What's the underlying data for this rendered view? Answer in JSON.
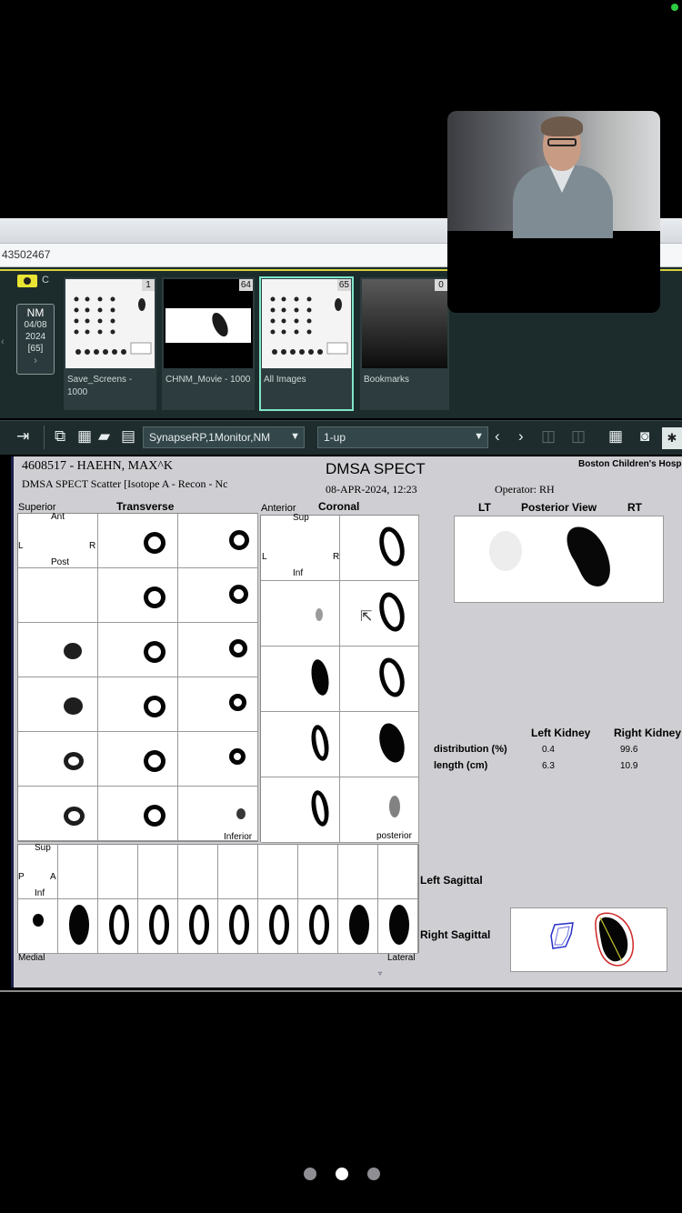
{
  "url_fragment": "43502467",
  "study": {
    "tag_letter": "C",
    "modality": "NM",
    "date_line1": "04/08",
    "date_line2": "2024",
    "count": "[65]",
    "chevron": "›"
  },
  "thumbnails": [
    {
      "label": "Save_Screens - 1000",
      "count": "1"
    },
    {
      "label": "CHNM_Movie - 1000",
      "count": "64"
    },
    {
      "label": "All Images",
      "count": "65"
    },
    {
      "label": "Bookmarks",
      "count": "0"
    }
  ],
  "toolbar": {
    "layout_select": "SynapseRP,1Monitor,NM",
    "view_select": "1-up"
  },
  "report": {
    "patient": "4608517 - HAEHN, MAX^K",
    "series_desc": "DMSA SPECT Scatter [Isotope A - Recon - Nc",
    "title": "DMSA SPECT",
    "date": "08-APR-2024, 12:23",
    "institution": "Boston Children's Hosp",
    "operator": "Operator: RH",
    "transverse": {
      "heading": "Transverse",
      "corner": "Superior",
      "ant": "Ant",
      "post": "Post",
      "l": "L",
      "r": "R",
      "inferior": "Inferior"
    },
    "coronal": {
      "heading": "Coronal",
      "corner": "Anterior",
      "sup": "Sup",
      "inf": "Inf",
      "l": "L",
      "r": "R",
      "posterior": "posterior"
    },
    "sagittal": {
      "sup": "Sup",
      "inf": "Inf",
      "p": "P",
      "a": "A",
      "medial": "Medial",
      "lateral": "Lateral",
      "left_label": "Left Sagittal",
      "right_label": "Right Sagittal"
    },
    "posterior_view": {
      "lt": "LT",
      "title": "Posterior View",
      "rt": "RT"
    },
    "stats": {
      "col_left": "Left Kidney",
      "col_right": "Right Kidney",
      "rows": [
        {
          "label": "distribution (%)",
          "left": "0.4",
          "right": "99.6"
        },
        {
          "label": "length (cm)",
          "left": "6.3",
          "right": "10.9"
        }
      ]
    }
  },
  "pager": {
    "count": 3,
    "active": 1
  }
}
